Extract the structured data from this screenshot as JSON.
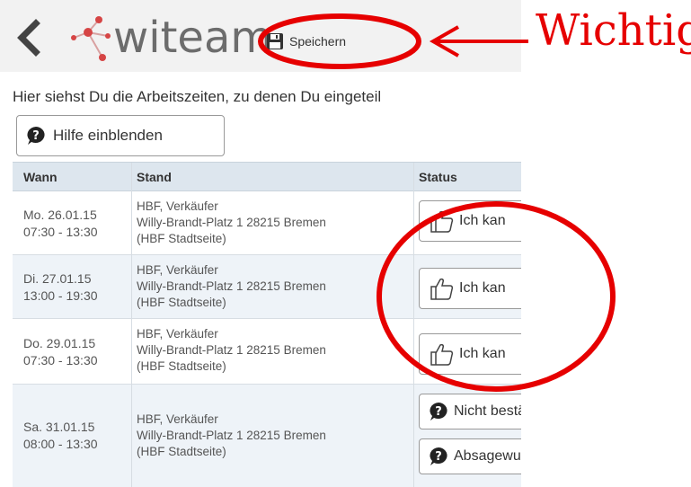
{
  "header": {
    "brand": "witeam",
    "save_label": "Speichern"
  },
  "intro_text": "Hier siehst Du die Arbeitszeiten, zu denen Du eingeteil",
  "help_button": "Hilfe einblenden",
  "table": {
    "columns": [
      "Wann",
      "Stand",
      "Status"
    ],
    "rows": [
      {
        "day": "Mo. 26.01.15",
        "time": "07:30 - 13:30",
        "stand1": "HBF, Verkäufer",
        "stand2": "Willy-Brandt-Platz 1 28215 Bremen",
        "stand3": "(HBF Stadtseite)",
        "status": "Ich kan"
      },
      {
        "day": "Di. 27.01.15",
        "time": "13:00 - 19:30",
        "stand1": "HBF, Verkäufer",
        "stand2": "Willy-Brandt-Platz 1 28215 Bremen",
        "stand3": "(HBF Stadtseite)",
        "status": "Ich kan"
      },
      {
        "day": "Do. 29.01.15",
        "time": "07:30 - 13:30",
        "stand1": "HBF, Verkäufer",
        "stand2": "Willy-Brandt-Platz 1 28215 Bremen",
        "stand3": "(HBF Stadtseite)",
        "status": "Ich kan"
      },
      {
        "day": "Sa. 31.01.15",
        "time": "08:00 - 13:30",
        "stand1": "HBF, Verkäufer",
        "stand2": "Willy-Brandt-Platz 1 28215 Bremen",
        "stand3": "(HBF Stadtseite)",
        "status": "Nicht bestätigt!",
        "status2": "Absagewunsch"
      }
    ]
  },
  "annotation": {
    "label": "Wichtig",
    "color": "#e60000"
  },
  "icons": [
    "back-chevron-icon",
    "witeam-logo-icon",
    "floppy-disk-icon",
    "question-mark-icon",
    "thumbs-up-icon"
  ]
}
